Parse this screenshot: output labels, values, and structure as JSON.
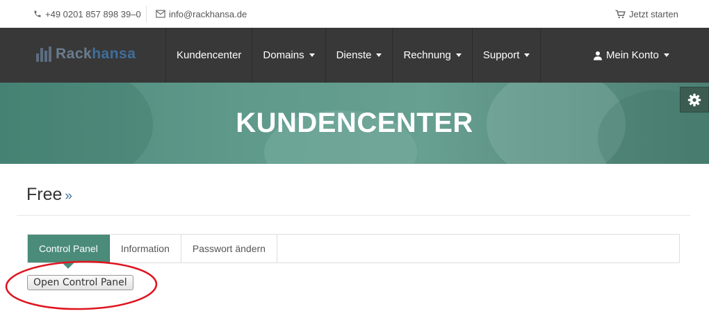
{
  "topbar": {
    "phone": "+49 0201 857 898 39–0",
    "email": "info@rackhansa.de",
    "cart": "Jetzt starten"
  },
  "logo": {
    "part1": "Rack",
    "part2": "hansa"
  },
  "nav": {
    "items": [
      {
        "label": "Kundencenter",
        "dropdown": false
      },
      {
        "label": "Domains",
        "dropdown": true
      },
      {
        "label": "Dienste",
        "dropdown": true
      },
      {
        "label": "Rechnung",
        "dropdown": true
      },
      {
        "label": "Support",
        "dropdown": true
      }
    ],
    "account": "Mein Konto"
  },
  "hero": {
    "title": "KUNDENCENTER"
  },
  "page": {
    "title": "Free",
    "raquo": "»"
  },
  "tabs": [
    {
      "label": "Control Panel",
      "active": true
    },
    {
      "label": "Information",
      "active": false
    },
    {
      "label": "Passwort ändern",
      "active": false
    }
  ],
  "panel": {
    "button": "Open Control Panel"
  },
  "colors": {
    "navbar": "#383838",
    "hero": "#5f9a8b",
    "active_tab": "#4a8b79",
    "annotation": "#e0141e",
    "brand_blue": "#3f6f9c"
  },
  "icons": [
    "phone-icon",
    "envelope-icon",
    "cart-icon",
    "user-icon",
    "gear-icon",
    "caret-down-icon"
  ]
}
